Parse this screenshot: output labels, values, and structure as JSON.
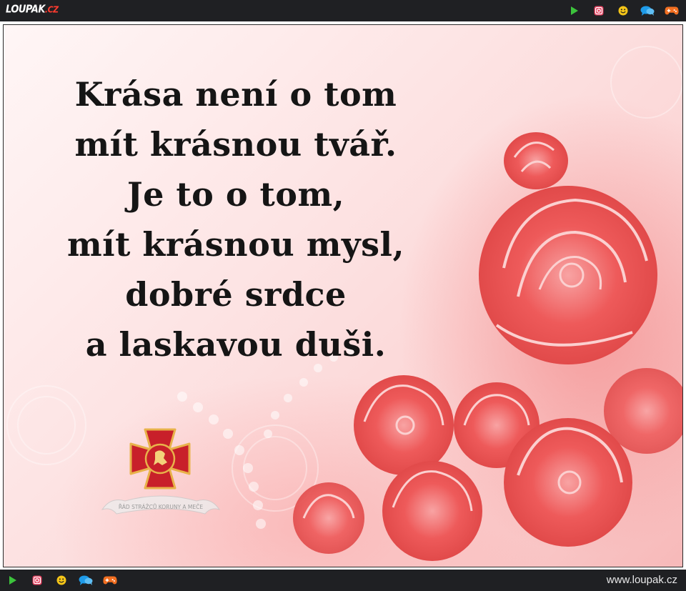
{
  "header": {
    "logo_main": "LOUPAK",
    "logo_tld": ".CZ",
    "icons": [
      "play-icon",
      "instagram-icon",
      "smiley-icon",
      "chat-icon",
      "gamepad-icon"
    ]
  },
  "quote": {
    "lines": [
      "Krása není o tom",
      "mít krásnou tvář.",
      "Je to o tom,",
      "mít krásnou mysl,",
      "dobré srdce",
      "a laskavou duši."
    ]
  },
  "emblem": {
    "caption": "ŘÁD STRÁŽCŮ KORUNY A MEČE"
  },
  "footer": {
    "url": "www.loupak.cz",
    "icons": [
      "play-icon",
      "instagram-icon",
      "smiley-icon",
      "chat-icon",
      "gamepad-icon"
    ]
  },
  "colors": {
    "bar": "#1f2023",
    "rose": "#ee5a5a",
    "play": "#3cc33c",
    "instagram": "#e4405f",
    "smiley": "#f5c518",
    "chat": "#1e9be9",
    "gamepad": "#f26f21",
    "logo_tld": "#ff3b2f"
  }
}
